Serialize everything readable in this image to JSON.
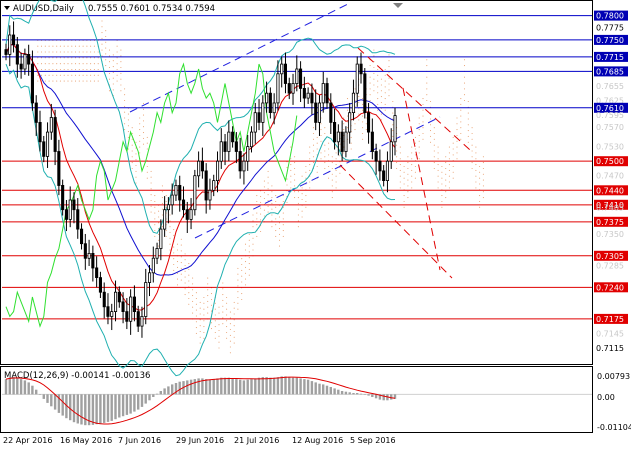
{
  "header": {
    "symbol": "AUDUSD,Daily",
    "ohlc": "0.7555 0.7601 0.7534 0.7594"
  },
  "macd": {
    "label": "MACD(12,26,9) -0.00141 -0.00136",
    "ticks": [
      "0.00793",
      "0.00",
      "-0.01104"
    ]
  },
  "colors": {
    "level_line": "#e00000",
    "blue_level": "#0000c8",
    "tag_red": "#e00000",
    "tag_blue": "#0000b4",
    "tag_gray": "#c8c8c8",
    "candle": "#000000",
    "macd_hist": "#a0a0a0",
    "macd_signal": "#e00000"
  },
  "chart_data": {
    "type": "candlestick",
    "title": "AUDUSD,Daily",
    "ylim": [
      0.7082,
      0.7826
    ],
    "x_labels": [
      "22 Apr 2016",
      "16 May 2016",
      "7 Jun 2016",
      "29 Jun 2016",
      "21 Jul 2016",
      "12 Aug 2016",
      "5 Sep 2016"
    ],
    "price_tags": [
      {
        "value": "0.7800",
        "style": "blue"
      },
      {
        "value": "0.7775",
        "style": "plain"
      },
      {
        "value": "0.7750",
        "style": "blue"
      },
      {
        "value": "0.7715",
        "style": "blue"
      },
      {
        "value": "0.7685",
        "style": "blue"
      },
      {
        "value": "0.7655",
        "style": "gray"
      },
      {
        "value": "0.7625",
        "style": "gray"
      },
      {
        "value": "0.7610",
        "style": "blue"
      },
      {
        "value": "0.7595",
        "style": "gray"
      },
      {
        "value": "0.7570",
        "style": "gray"
      },
      {
        "value": "0.7530",
        "style": "gray"
      },
      {
        "value": "0.7500",
        "style": "red"
      },
      {
        "value": "0.7470",
        "style": "gray"
      },
      {
        "value": "0.7440",
        "style": "red"
      },
      {
        "value": "0.7410",
        "style": "red"
      },
      {
        "value": "0.7405",
        "style": "gray"
      },
      {
        "value": "0.7375",
        "style": "red"
      },
      {
        "value": "0.7350",
        "style": "gray"
      },
      {
        "value": "0.7305",
        "style": "red"
      },
      {
        "value": "0.7285",
        "style": "gray"
      },
      {
        "value": "0.7240",
        "style": "red"
      },
      {
        "value": "0.7175",
        "style": "red"
      },
      {
        "value": "0.7145",
        "style": "gray"
      },
      {
        "value": "0.7115",
        "style": "plain"
      }
    ],
    "levels": [
      {
        "value": 0.78,
        "color": "blue"
      },
      {
        "value": 0.775,
        "color": "blue"
      },
      {
        "value": 0.7715,
        "color": "blue"
      },
      {
        "value": 0.7685,
        "color": "blue"
      },
      {
        "value": 0.761,
        "color": "blue"
      },
      {
        "value": 0.75,
        "color": "red"
      },
      {
        "value": 0.744,
        "color": "red"
      },
      {
        "value": 0.741,
        "color": "red"
      },
      {
        "value": 0.7375,
        "color": "red"
      },
      {
        "value": 0.7305,
        "color": "red"
      },
      {
        "value": 0.724,
        "color": "red"
      },
      {
        "value": 0.7175,
        "color": "red"
      }
    ],
    "close": [
      0.772,
      0.776,
      0.774,
      0.77,
      0.769,
      0.772,
      0.77,
      0.762,
      0.758,
      0.754,
      0.751,
      0.756,
      0.759,
      0.752,
      0.745,
      0.74,
      0.738,
      0.742,
      0.74,
      0.736,
      0.733,
      0.73,
      0.731,
      0.728,
      0.726,
      0.723,
      0.72,
      0.718,
      0.719,
      0.723,
      0.721,
      0.719,
      0.717,
      0.722,
      0.719,
      0.716,
      0.718,
      0.725,
      0.727,
      0.73,
      0.732,
      0.736,
      0.74,
      0.741,
      0.743,
      0.745,
      0.742,
      0.74,
      0.738,
      0.74,
      0.747,
      0.75,
      0.748,
      0.742,
      0.744,
      0.746,
      0.75,
      0.754,
      0.752,
      0.756,
      0.754,
      0.752,
      0.748,
      0.75,
      0.753,
      0.756,
      0.76,
      0.758,
      0.762,
      0.764,
      0.76,
      0.762,
      0.768,
      0.77,
      0.766,
      0.764,
      0.766,
      0.769,
      0.765,
      0.763,
      0.764,
      0.762,
      0.758,
      0.762,
      0.766,
      0.762,
      0.758,
      0.754,
      0.756,
      0.752,
      0.756,
      0.76,
      0.764,
      0.77,
      0.768,
      0.76,
      0.756,
      0.752,
      0.75,
      0.748,
      0.746,
      0.75,
      0.754,
      0.7594
    ],
    "macd_hist": [
      0.0046,
      0.005,
      0.0052,
      0.005,
      0.0046,
      0.0042,
      0.0036,
      0.0026,
      0.0014,
      0.0,
      -0.0014,
      -0.0026,
      -0.0036,
      -0.0046,
      -0.0056,
      -0.0064,
      -0.0072,
      -0.0078,
      -0.0084,
      -0.0088,
      -0.0091,
      -0.0093,
      -0.0093,
      -0.0092,
      -0.009,
      -0.0088,
      -0.0086,
      -0.0083,
      -0.008,
      -0.0075,
      -0.007,
      -0.0066,
      -0.0062,
      -0.0058,
      -0.0052,
      -0.0046,
      -0.0038,
      -0.0028,
      -0.0018,
      -0.0008,
      0.0002,
      0.001,
      0.0018,
      0.0024,
      0.003,
      0.0034,
      0.0038,
      0.004,
      0.0042,
      0.0044,
      0.0046,
      0.0048,
      0.0048,
      0.0046,
      0.0044,
      0.0046,
      0.0048,
      0.005,
      0.005,
      0.005,
      0.0048,
      0.0046,
      0.0044,
      0.0042,
      0.0044,
      0.0046,
      0.0048,
      0.005,
      0.0052,
      0.0052,
      0.005,
      0.005,
      0.0052,
      0.0054,
      0.0054,
      0.0052,
      0.005,
      0.005,
      0.0048,
      0.0046,
      0.0044,
      0.004,
      0.0036,
      0.0032,
      0.003,
      0.0026,
      0.0022,
      0.0018,
      0.0014,
      0.001,
      0.0008,
      0.0006,
      0.0004,
      0.0004,
      0.0002,
      0.0,
      -0.0004,
      -0.0008,
      -0.0012,
      -0.0016,
      -0.0018,
      -0.0018,
      -0.0016,
      -0.0014
    ]
  }
}
